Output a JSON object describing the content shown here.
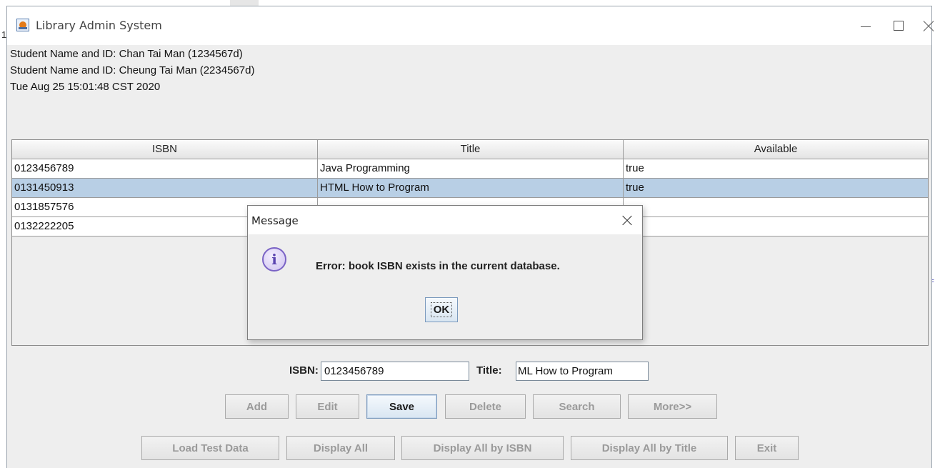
{
  "window": {
    "title": "Library Admin System"
  },
  "info": {
    "line1": "Student Name and ID: Chan Tai Man (1234567d)",
    "line2": "Student Name and ID: Cheung Tai Man (2234567d)",
    "line3": "Tue Aug 25 15:01:48 CST 2020"
  },
  "table": {
    "columns": [
      "ISBN",
      "Title",
      "Available"
    ],
    "rows": [
      {
        "isbn": "0123456789",
        "title": "Java Programming",
        "available": "true",
        "selected": false
      },
      {
        "isbn": "0131450913",
        "title": "HTML How to Program",
        "available": "true",
        "selected": true
      },
      {
        "isbn": "0131857576",
        "title": "",
        "available": "",
        "selected": false
      },
      {
        "isbn": "0132222205",
        "title": "",
        "available": "",
        "selected": false
      }
    ]
  },
  "form": {
    "isbn_label": "ISBN:",
    "isbn_value": "0123456789",
    "title_label": "Title:",
    "title_value": "ML How to Program"
  },
  "buttons_row1": {
    "add": "Add",
    "edit": "Edit",
    "save": "Save",
    "delete": "Delete",
    "search": "Search",
    "more": "More>>"
  },
  "buttons_row2": {
    "load_test_data": "Load Test Data",
    "display_all": "Display All",
    "display_all_isbn": "Display All by ISBN",
    "display_all_title": "Display All by Title",
    "exit": "Exit"
  },
  "dialog": {
    "title": "Message",
    "message": "Error: book ISBN exists in the current database.",
    "ok": "OK"
  },
  "colors": {
    "selected_row": "#b8cfe5",
    "window_bg": "#eeeeee"
  }
}
